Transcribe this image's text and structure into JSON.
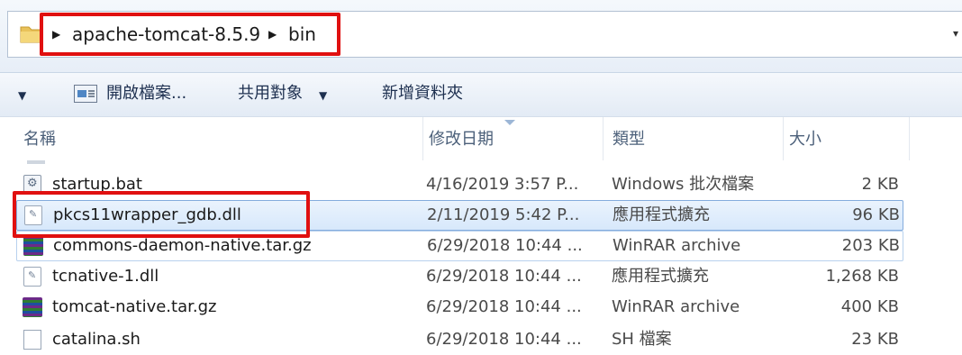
{
  "address": {
    "crumbs": [
      "apache-tomcat-8.5.9",
      "bin"
    ],
    "separator_icon": "triangle-right-icon",
    "dropdown_icon": "chevron-down-icon"
  },
  "toolbar": {
    "organize_caret": "▼",
    "open_label": "開啟檔案...",
    "share_label": "共用對象",
    "share_caret": "▼",
    "new_folder_label": "新增資料夾"
  },
  "columns": {
    "name": "名稱",
    "modified": "修改日期",
    "type": "類型",
    "size": "大小"
  },
  "files": [
    {
      "name": "startup.bat",
      "modified": "4/16/2019 3:57 P...",
      "type": "Windows 批次檔案",
      "size": "2 KB",
      "icon": "batch-file-icon"
    },
    {
      "name": "pkcs11wrapper_gdb.dll",
      "modified": "2/11/2019 5:42 P...",
      "type": "應用程式擴充",
      "size": "96 KB",
      "icon": "dll-file-icon"
    },
    {
      "name": "commons-daemon-native.tar.gz",
      "modified": "6/29/2018 10:44 ...",
      "type": "WinRAR archive",
      "size": "203 KB",
      "icon": "winrar-archive-icon"
    },
    {
      "name": "tcnative-1.dll",
      "modified": "6/29/2018 10:44 ...",
      "type": "應用程式擴充",
      "size": "1,268 KB",
      "icon": "dll-file-icon"
    },
    {
      "name": "tomcat-native.tar.gz",
      "modified": "6/29/2018 10:44 ...",
      "type": "WinRAR archive",
      "size": "400 KB",
      "icon": "winrar-archive-icon"
    },
    {
      "name": "catalina.sh",
      "modified": "6/29/2018 10:44 ...",
      "type": "SH 檔案",
      "size": "23 KB",
      "icon": "generic-file-icon"
    }
  ],
  "colors": {
    "highlight_red": "#e01010",
    "selection_border": "#84acdd"
  }
}
